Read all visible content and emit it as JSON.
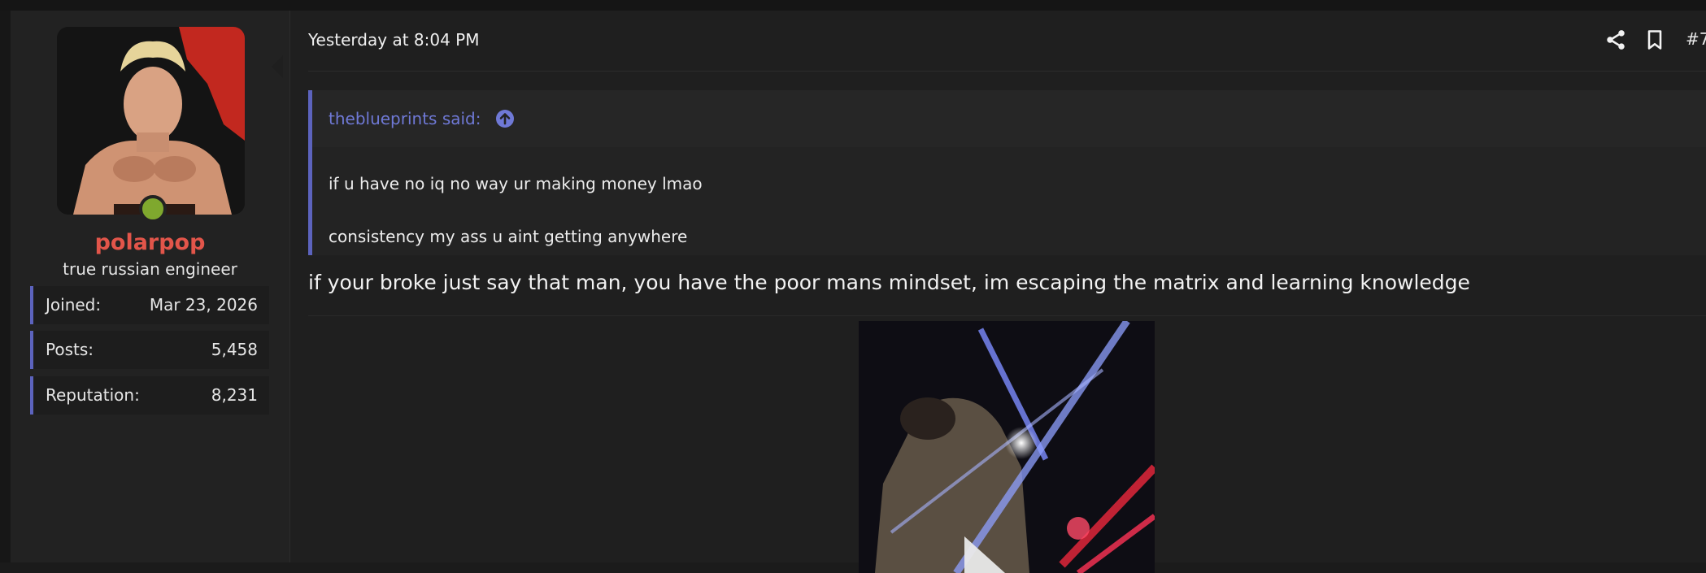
{
  "user": {
    "username": "polarpop",
    "title": "true russian engineer",
    "online": true,
    "stats": [
      {
        "label": "Joined:",
        "value": "Mar 23, 2026"
      },
      {
        "label": "Posts:",
        "value": "5,458"
      },
      {
        "label": "Reputation:",
        "value": "8,231"
      }
    ]
  },
  "post": {
    "date": "Yesterday at 8:04 PM",
    "number": "#7",
    "icons": {
      "share": "share-icon",
      "bookmark": "bookmark-icon",
      "jump": "arrow-up-circle-icon",
      "play": "play-icon"
    },
    "quote": {
      "author": "theblueprints said:",
      "lines": [
        "if u have no iq no way ur making money lmao",
        "consistency my ass u aint getting anywhere"
      ]
    },
    "message": "if your broke just say that man, you have the poor mans mindset, im escaping the matrix and learning knowledge"
  },
  "colors": {
    "accent": "#5c63bd",
    "quote_author": "#6f79d6",
    "username": "#e2554a",
    "online": "#7fa82e",
    "background": "#1f1f1f"
  }
}
